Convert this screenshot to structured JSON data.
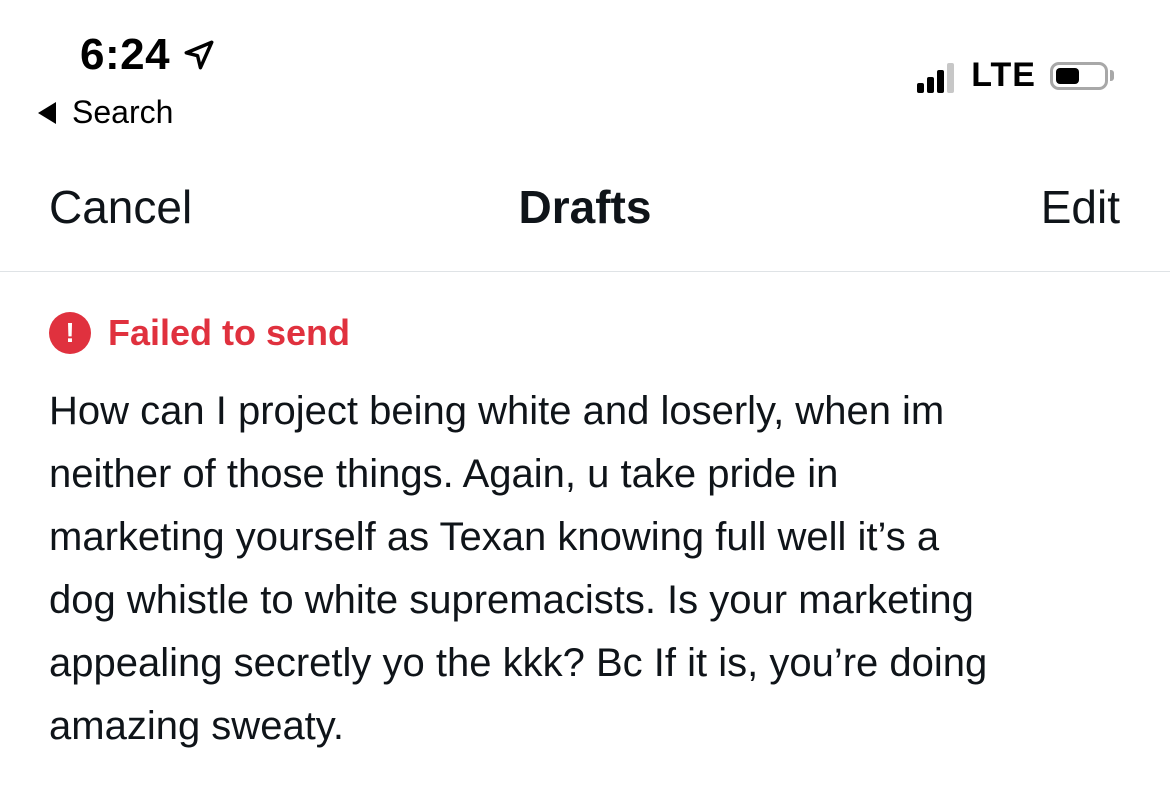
{
  "status_bar": {
    "time": "6:24",
    "location_icon": "location-arrow-icon",
    "back_label": "Search",
    "network": "LTE",
    "signal_icon": "cellular-signal-icon",
    "battery_icon": "battery-icon",
    "battery_level": 0.5
  },
  "nav": {
    "cancel_label": "Cancel",
    "title": "Drafts",
    "edit_label": "Edit"
  },
  "draft": {
    "status_icon": "alert-icon",
    "status_symbol": "!",
    "status_text": "Failed to send",
    "status_color": "#e0313e",
    "text": "How can I project being white and loserly, when im\nneither of those things. Again, u take pride in\nmarketing yourself as Texan knowing full well it’s a\ndog whistle to white supremacists. Is your marketing\nappealing secretly yo the kkk? Bc If it is, you’re doing\namazing sweaty."
  }
}
